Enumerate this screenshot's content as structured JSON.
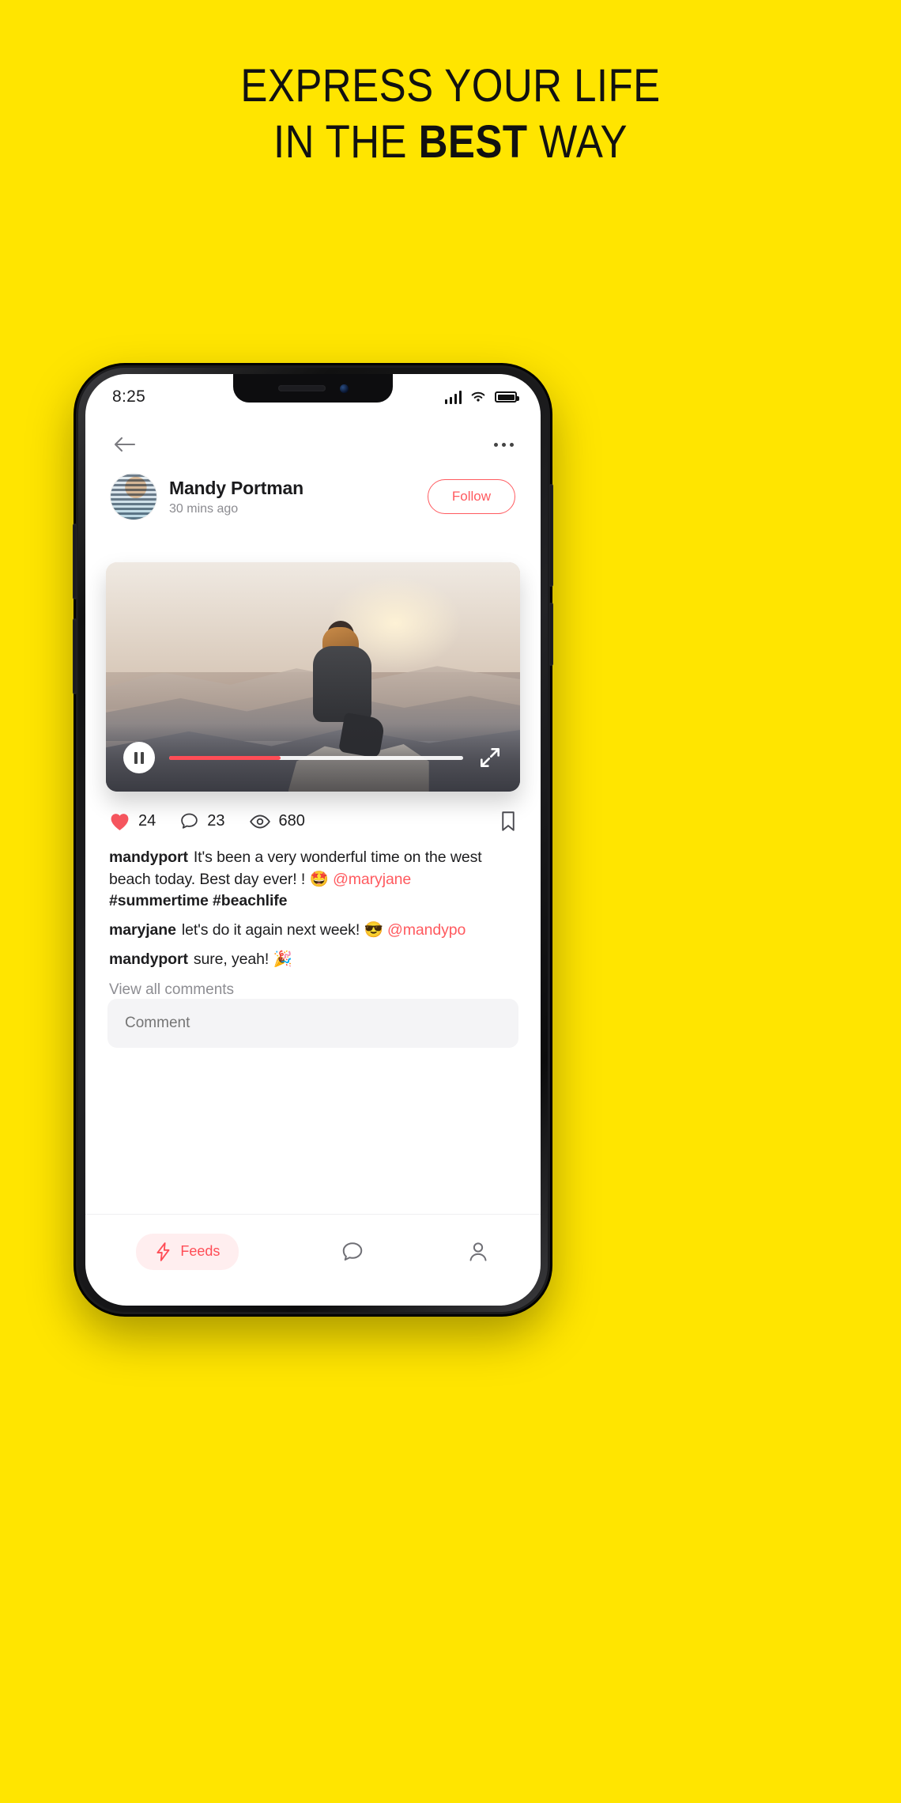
{
  "promo": {
    "line1": "EXPRESS YOUR LIFE",
    "line2_pre": "IN THE ",
    "line2_bold": "BEST",
    "line2_post": " WAY",
    "background_color": "#FFE500"
  },
  "status_bar": {
    "time": "8:25",
    "signal_icon": "cellular-signal-icon",
    "wifi_icon": "wifi-icon",
    "battery_icon": "battery-full-icon"
  },
  "top_bar": {
    "back_icon": "back-arrow-icon",
    "more_icon": "more-options-icon"
  },
  "post": {
    "author_name": "Mandy Portman",
    "timestamp": "30 mins ago",
    "follow_label": "Follow",
    "avatar_icon": "user-avatar",
    "accent_color": "#ff5a5f"
  },
  "video": {
    "play_icon": "pause-icon",
    "expand_icon": "fullscreen-expand-icon",
    "progress_percent": 38,
    "progress_color": "#ff4d56"
  },
  "engagement": {
    "like_icon": "heart-filled-icon",
    "like_count": "24",
    "comment_icon": "comment-bubble-icon",
    "comment_count": "23",
    "view_icon": "eye-icon",
    "view_count": "680",
    "bookmark_icon": "bookmark-icon"
  },
  "comments": {
    "items": [
      {
        "user": "mandyport",
        "text": "It's been a very wonderful time on the west beach today. Best day ever! !",
        "emoji": "🤩",
        "mention": "@maryjane",
        "hashtags": "#summertime #beachlife"
      },
      {
        "user": "maryjane",
        "text": "let's do it again next week!",
        "emoji": "😎",
        "mention": "@mandypo",
        "hashtags": ""
      },
      {
        "user": "mandyport",
        "text": "sure, yeah!",
        "emoji": "🎉",
        "mention": "",
        "hashtags": ""
      }
    ],
    "view_all_label": "View all comments"
  },
  "comment_input": {
    "placeholder": "Comment",
    "value": ""
  },
  "bottom_nav": {
    "items": [
      {
        "label": "Feeds",
        "icon": "lightning-bolt-icon",
        "active": true
      },
      {
        "label": "",
        "icon": "chat-bubble-icon",
        "active": false
      },
      {
        "label": "",
        "icon": "profile-person-icon",
        "active": false
      }
    ]
  }
}
